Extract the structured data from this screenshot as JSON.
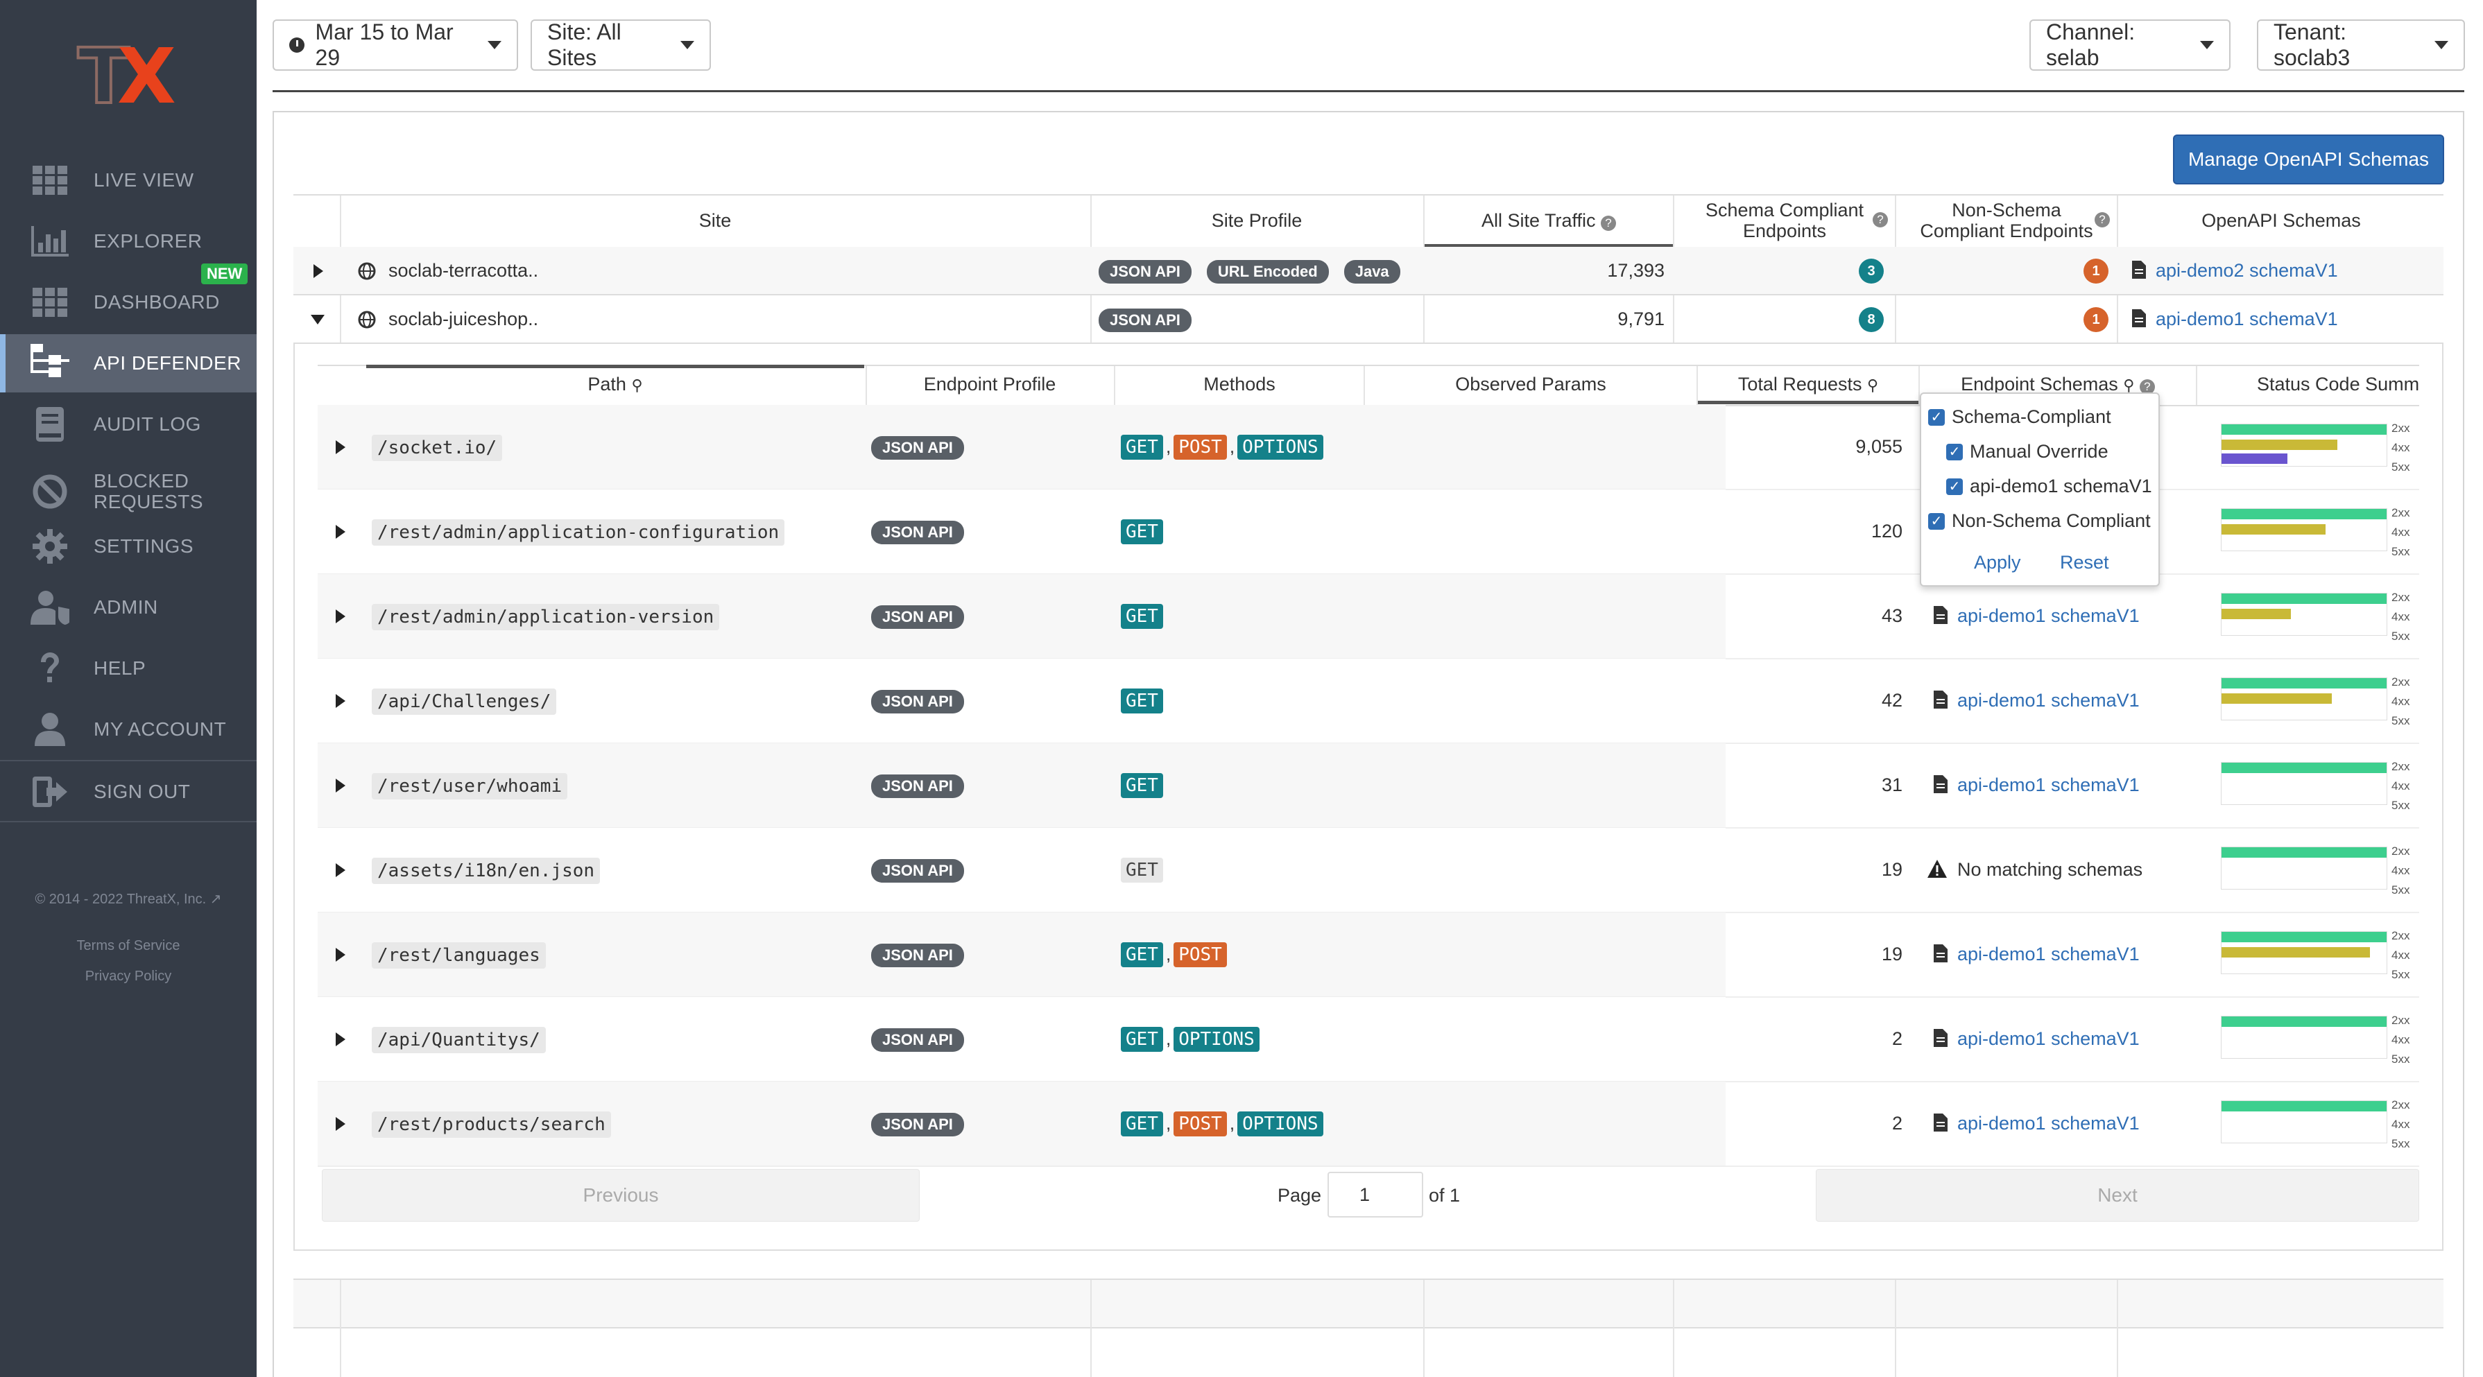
{
  "sidebar": {
    "logo": {
      "t": "T",
      "x": "X"
    },
    "items": [
      {
        "label": "LIVE VIEW",
        "icon": "grid-icon"
      },
      {
        "label": "EXPLORER",
        "icon": "bar-chart-icon"
      },
      {
        "label": "DASHBOARD",
        "icon": "grid-icon",
        "badge": "NEW"
      },
      {
        "label": "API DEFENDER",
        "icon": "hierarchy-icon",
        "active": true
      },
      {
        "label": "AUDIT LOG",
        "icon": "book-icon"
      },
      {
        "label": "BLOCKED",
        "label2": "REQUESTS",
        "icon": "ban-icon"
      },
      {
        "label": "SETTINGS",
        "icon": "gear-icon"
      },
      {
        "label": "ADMIN",
        "icon": "user-shield-icon"
      },
      {
        "label": "HELP",
        "icon": "question-icon"
      },
      {
        "label": "MY ACCOUNT",
        "icon": "user-icon"
      },
      {
        "label": "SIGN OUT",
        "icon": "sign-out-icon"
      }
    ],
    "copyright": "© 2014 - 2022 ThreatX, Inc.",
    "terms": "Terms of Service",
    "privacy": "Privacy Policy"
  },
  "topbar": {
    "date_range": "Mar 15 to Mar 29",
    "site": "Site: All Sites",
    "channel": "Channel: selab",
    "tenant": "Tenant: soclab3"
  },
  "manage_button": "Manage OpenAPI Schemas",
  "sites_table": {
    "headers": {
      "site": "Site",
      "profile": "Site Profile",
      "traffic": "All Site Traffic",
      "compliant_1": "Schema Compliant",
      "compliant_2": "Endpoints",
      "noncompliant_1": "Non-Schema",
      "noncompliant_2": "Compliant Endpoints",
      "schemas": "OpenAPI Schemas"
    },
    "rows": [
      {
        "name": "soclab-terracotta..",
        "profiles": [
          "JSON API",
          "URL Encoded",
          "Java"
        ],
        "traffic": "17,393",
        "compliant": "3",
        "noncompliant": "1",
        "schema": "api-demo2 schemaV1"
      },
      {
        "name": "soclab-juiceshop..",
        "profiles": [
          "JSON API"
        ],
        "traffic": "9,791",
        "compliant": "8",
        "noncompliant": "1",
        "schema": "api-demo1 schemaV1"
      }
    ]
  },
  "endpoints_table": {
    "headers": {
      "path": "Path",
      "profile": "Endpoint Profile",
      "methods": "Methods",
      "params": "Observed Params",
      "requests": "Total Requests",
      "schemas": "Endpoint Schemas",
      "status": "Status Code Summ"
    },
    "legend": [
      "2xx",
      "4xx",
      "5xx"
    ],
    "rows": [
      {
        "path": "/socket.io/",
        "profile": "JSON API",
        "methods": [
          "GET",
          "POST",
          "OPTIONS"
        ],
        "requests": "9,055",
        "schema": "",
        "s2xx": 1.0,
        "s4xx": 0.7,
        "s5xx": 0.4
      },
      {
        "path": "/rest/admin/application-configuration",
        "profile": "JSON API",
        "methods": [
          "GET"
        ],
        "requests": "120",
        "schema": "",
        "s2xx": 1.0,
        "s4xx": 0.63,
        "s5xx": 0
      },
      {
        "path": "/rest/admin/application-version",
        "profile": "JSON API",
        "methods": [
          "GET"
        ],
        "requests": "43",
        "schema": "api-demo1 schemaV1",
        "s2xx": 1.0,
        "s4xx": 0.42,
        "s5xx": 0
      },
      {
        "path": "/api/Challenges/",
        "profile": "JSON API",
        "methods": [
          "GET"
        ],
        "requests": "42",
        "schema": "api-demo1 schemaV1",
        "s2xx": 1.0,
        "s4xx": 0.67,
        "s5xx": 0
      },
      {
        "path": "/rest/user/whoami",
        "profile": "JSON API",
        "methods": [
          "GET"
        ],
        "requests": "31",
        "schema": "api-demo1 schemaV1",
        "s2xx": 1.0,
        "s4xx": 0,
        "s5xx": 0
      },
      {
        "path": "/assets/i18n/en.json",
        "profile": "JSON API",
        "methods": [
          "GET"
        ],
        "requests": "19",
        "schema": "",
        "warning": "No matching schemas",
        "s2xx": 1.0,
        "s4xx": 0,
        "s5xx": 0
      },
      {
        "path": "/rest/languages",
        "profile": "JSON API",
        "methods": [
          "GET",
          "POST"
        ],
        "requests": "19",
        "schema": "api-demo1 schemaV1",
        "s2xx": 1.0,
        "s4xx": 0.9,
        "s5xx": 0
      },
      {
        "path": "/api/Quantitys/",
        "profile": "JSON API",
        "methods": [
          "GET",
          "OPTIONS"
        ],
        "requests": "2",
        "schema": "api-demo1 schemaV1",
        "s2xx": 1.0,
        "s4xx": 0,
        "s5xx": 0
      },
      {
        "path": "/rest/products/search",
        "profile": "JSON API",
        "methods": [
          "GET",
          "POST",
          "OPTIONS"
        ],
        "requests": "2",
        "schema": "api-demo1 schemaV1",
        "s2xx": 1.0,
        "s4xx": 0,
        "s5xx": 0
      }
    ]
  },
  "schema_filter": {
    "options": [
      {
        "label": "Schema-Compliant",
        "checked": true
      },
      {
        "label": "Manual Override",
        "checked": true
      },
      {
        "label": "api-demo1 schemaV1",
        "checked": true
      },
      {
        "label": "Non-Schema Compliant",
        "checked": true
      }
    ],
    "apply": "Apply",
    "reset": "Reset"
  },
  "pager": {
    "previous": "Previous",
    "page_label": "Page",
    "page": "1",
    "of": "of 1",
    "next": "Next"
  },
  "colors": {
    "s2xx": "#3dcf8e",
    "s4xx": "#c9b937",
    "s5xx": "#6a55cf",
    "accent": "#2f6eb5",
    "badge_teal": "#14818a",
    "badge_orange": "#d6632b"
  }
}
